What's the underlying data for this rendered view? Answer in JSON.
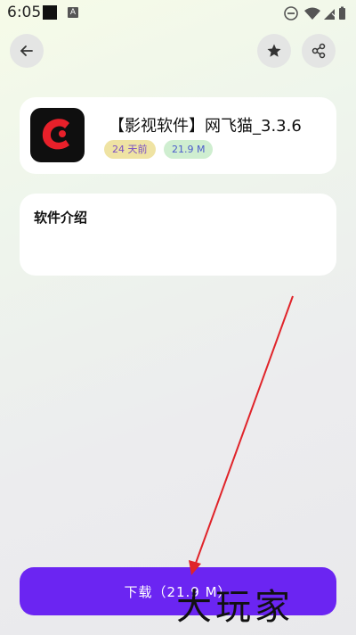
{
  "status_bar": {
    "time": "6:05",
    "notification_a": "A"
  },
  "header": {
    "back_icon": "arrow-left-icon",
    "star_icon": "star-icon",
    "share_icon": "share-icon"
  },
  "app": {
    "title": "【影视软件】网飞猫_3.3.6",
    "date_tag": "24 天前",
    "size_tag": "21.9 M",
    "icon": "app-logo"
  },
  "intro": {
    "title": "软件介绍",
    "body": ""
  },
  "download": {
    "label": "下载（21.9 M）"
  },
  "watermark": {
    "text": "大玩家"
  },
  "colors": {
    "accent": "#6b25f2",
    "date_tag_bg": "#efe3a3",
    "size_tag_bg": "#cfeed0",
    "arrow": "#e0242a"
  }
}
